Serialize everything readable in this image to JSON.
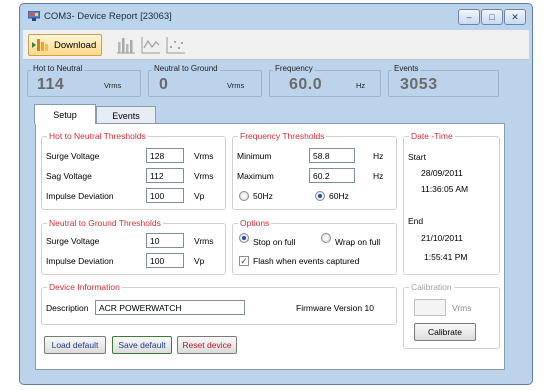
{
  "window": {
    "title": "COM3- Device Report [23063]",
    "buttons": {
      "minimize": "–",
      "maximize": "□",
      "close": "✕"
    }
  },
  "toolbar": {
    "download_label": "Download",
    "icons": [
      "bar-chart-icon",
      "line-chart-icon",
      "scatter-chart-icon"
    ]
  },
  "stats": {
    "hot_to_neutral": {
      "label": "Hot to Neutral",
      "value": "114",
      "unit": "Vrms"
    },
    "neutral_to_ground": {
      "label": "Neutral to Ground",
      "value": "0",
      "unit": "Vrms"
    },
    "frequency": {
      "label": "Frequency",
      "value": "60.0",
      "unit": "Hz"
    },
    "events": {
      "label": "Events",
      "value": "3053"
    }
  },
  "tabs": [
    {
      "label": "Setup",
      "active": true
    },
    {
      "label": "Events",
      "active": false
    }
  ],
  "hot_neutral": {
    "title": "Hot to Neutral Thresholds",
    "rows": [
      {
        "label": "Surge Voltage",
        "value": "128",
        "unit": "Vrms"
      },
      {
        "label": "Sag Voltage",
        "value": "112",
        "unit": "Vrms"
      },
      {
        "label": "Impulse Deviation",
        "value": "100",
        "unit": "Vp"
      }
    ]
  },
  "neutral_ground": {
    "title": "Neutral to Ground Thresholds",
    "rows": [
      {
        "label": "Surge Voltage",
        "value": "10",
        "unit": "Vrms"
      },
      {
        "label": "Impulse Deviation",
        "value": "100",
        "unit": "Vp"
      }
    ]
  },
  "frequency_thresholds": {
    "title": "Frequency Thresholds",
    "rows": [
      {
        "label": "Minimum",
        "value": "58.8",
        "unit": "Hz"
      },
      {
        "label": "Maximum",
        "value": "60.2",
        "unit": "Hz"
      }
    ],
    "options": [
      {
        "label": "50Hz",
        "checked": false
      },
      {
        "label": "60Hz",
        "checked": true
      }
    ]
  },
  "options": {
    "title": "Options",
    "stop_on_full": {
      "label": "Stop on full",
      "checked": true
    },
    "wrap_on_full": {
      "label": "Wrap on full",
      "checked": false
    },
    "flash": {
      "label": "Flash when events captured",
      "checked": true,
      "mark": "✓"
    }
  },
  "datetime": {
    "title": "Date -Time",
    "start_label": "Start",
    "start_date": "28/09/2011",
    "start_time": "11:36:05 AM",
    "end_label": "End",
    "end_date": "21/10/2011",
    "end_time": "1:55:41 PM"
  },
  "device_info": {
    "title": "Device Information",
    "description_label": "Description",
    "description_value": "ACR POWERWATCH",
    "firmware": "Firmware Version 10"
  },
  "calibration": {
    "title": "Calibration",
    "value": "",
    "unit": "Vrms",
    "button": "Calibrate"
  },
  "actions": {
    "load_default": "Load default",
    "save_default": "Save default",
    "reset_device": "Reset device"
  },
  "colors": {
    "window_bg": "#bcd3ec",
    "group_title": "#c8323a",
    "stat_value": "#6b6b6b",
    "accent_blue": "#1c3d8c",
    "accent_red": "#b41e2a"
  }
}
